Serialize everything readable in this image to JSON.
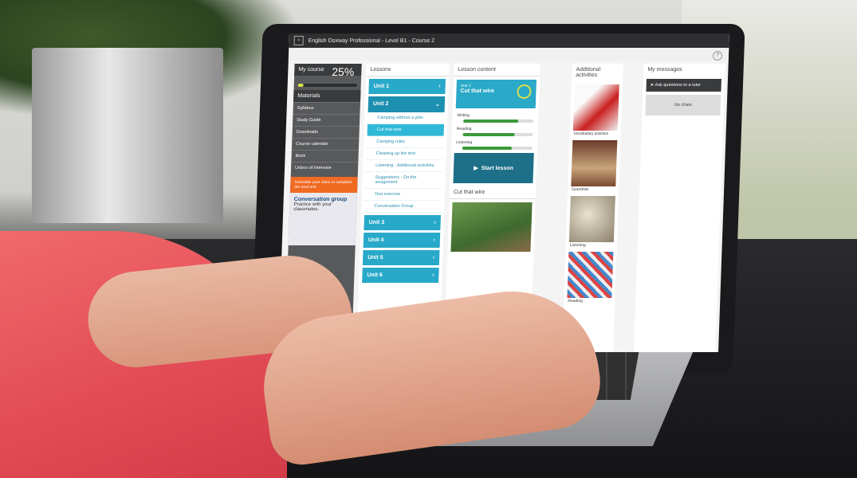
{
  "window": {
    "title": "English Doxway Professional - Level B1 - Course 2"
  },
  "my_course": {
    "header": "My course",
    "progress_value": "25",
    "progress_unit": "%",
    "progress_fraction": 0.1,
    "materials_header": "Materials",
    "materials": [
      "Syllabus",
      "Study Guide",
      "Downloads",
      "Course calendar",
      "Book",
      "Unbox of Intensive"
    ],
    "promo": "Schedule your class to complete the next unit",
    "conversation": {
      "title": "Conversation group",
      "text": "Practice with your classmates."
    }
  },
  "lessons": {
    "header": "Lessons",
    "units": [
      {
        "label": "Unit 1"
      },
      {
        "label": "Unit 2",
        "items": [
          "Camping without a plan",
          "Cut that wire",
          "Camping rules",
          "Cleaning up the tent",
          "Listening - Additional activities",
          "Suggestions - On the assignment",
          "Test exercise",
          "Conversation Group"
        ]
      },
      {
        "label": "Unit 3"
      },
      {
        "label": "Unit 4"
      },
      {
        "label": "Unit 5"
      },
      {
        "label": "Unit 6"
      }
    ]
  },
  "lesson_content": {
    "header": "Lesson content",
    "card_small": "Unit 2",
    "card_title": "Cut that wire",
    "skills": [
      {
        "name": "Writing",
        "value": 0.78
      },
      {
        "name": "Reading",
        "value": 0.74
      },
      {
        "name": "Listening",
        "value": 0.7
      }
    ],
    "start_label": "Start lesson",
    "preview_title": "Cut that wire"
  },
  "additional": {
    "header": "Additional activities",
    "items": [
      "Vocabulary practice",
      "Grammar",
      "Listening",
      "Reading"
    ]
  },
  "messages": {
    "header": "My messages",
    "ask_button": "Ask questions to a tutor",
    "empty": "No chats"
  },
  "colors": {
    "accent": "#29a9c9",
    "dark": "#3a3b3d",
    "promo": "#f06a22"
  }
}
